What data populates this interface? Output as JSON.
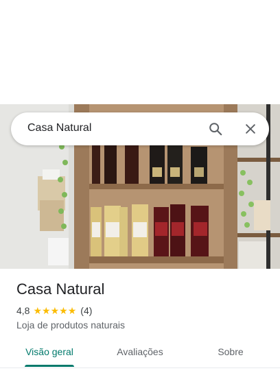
{
  "search": {
    "query": "Casa Natural"
  },
  "icons": {
    "search": "search-icon",
    "close": "close-icon",
    "star": "star-icon"
  },
  "place": {
    "name": "Casa Natural",
    "rating": "4,8",
    "stars": 5,
    "review_count": "(4)",
    "category": "Loja de produtos naturais"
  },
  "tabs": [
    {
      "label": "Visão geral",
      "active": true
    },
    {
      "label": "Avaliações",
      "active": false
    },
    {
      "label": "Sobre",
      "active": false
    }
  ],
  "colors": {
    "accent": "#00796b",
    "star": "#fbbc04"
  }
}
